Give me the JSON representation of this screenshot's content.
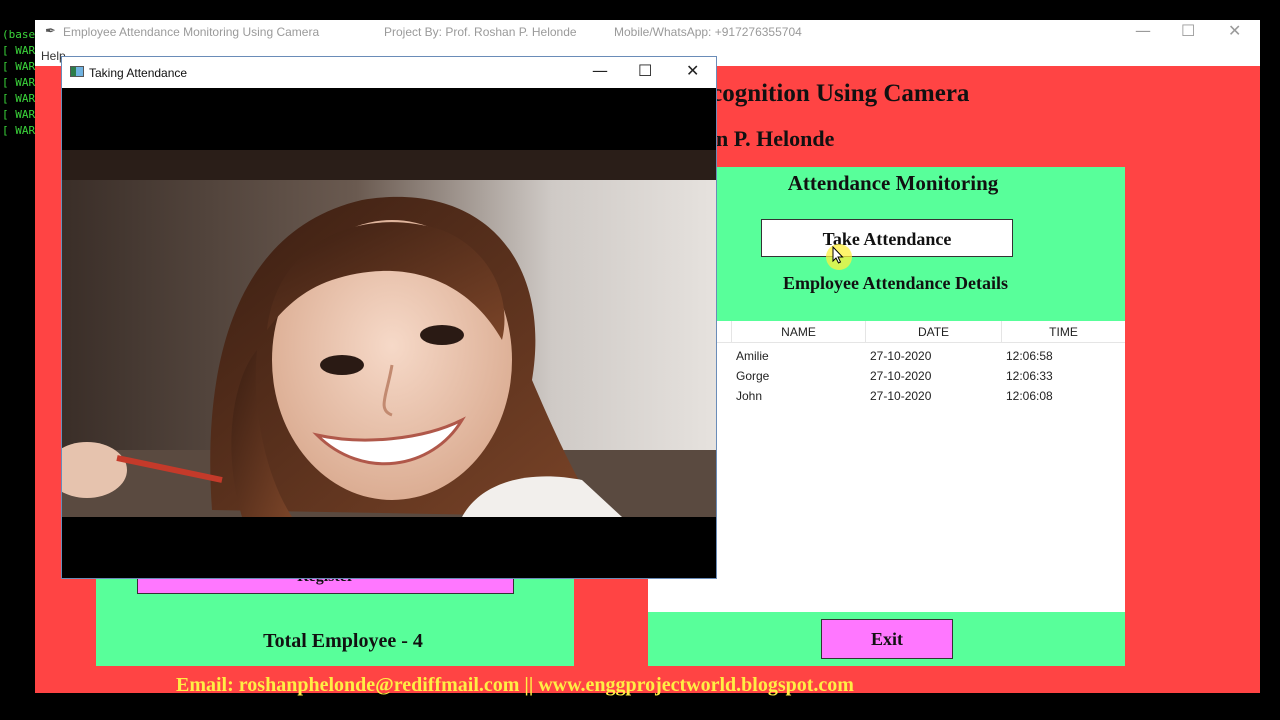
{
  "terminal": {
    "lines": [
      "(base",
      "[ WAR",
      "[ WAR",
      "[ WAR",
      "[ WAR",
      "[ WAR",
      "[ WAR"
    ]
  },
  "main_window": {
    "title": "Employee Attendance Monitoring Using Camera",
    "project_by": "Project By: Prof. Roshan P. Helonde",
    "mobile": "Mobile/WhatsApp: +917276355704",
    "menu_help": "Help",
    "heading_partial": "ecognition Using Camera",
    "author_partial": "n P. Helonde"
  },
  "attendance": {
    "title": "Attendance Monitoring",
    "take_button": "Take Attendance",
    "details_label": "Employee Attendance Details",
    "columns": [
      "NAME",
      "DATE",
      "TIME"
    ],
    "rows": [
      [
        "Amilie",
        "27-10-2020",
        "12:06:58"
      ],
      [
        "Gorge",
        "27-10-2020",
        "12:06:33"
      ],
      [
        "John",
        "27-10-2020",
        "12:06:08"
      ]
    ],
    "exit_button": "Exit"
  },
  "registration": {
    "register_button": "Register",
    "total_employee": "Total Employee - 4"
  },
  "footer": {
    "email_line": "Email: roshanphelonde@rediffmail.com || www.enggprojectworld.blogspot.com"
  },
  "camera_window": {
    "title": "Taking Attendance",
    "minimize_glyph": "—",
    "maximize_glyph": "☐",
    "close_glyph": "✕"
  },
  "colors": {
    "background_red": "#ff4444",
    "panel_green": "#58ff9a",
    "button_pink": "#ff77ff",
    "footer_yellow": "#ffee44",
    "terminal_green": "#3bd63b"
  }
}
